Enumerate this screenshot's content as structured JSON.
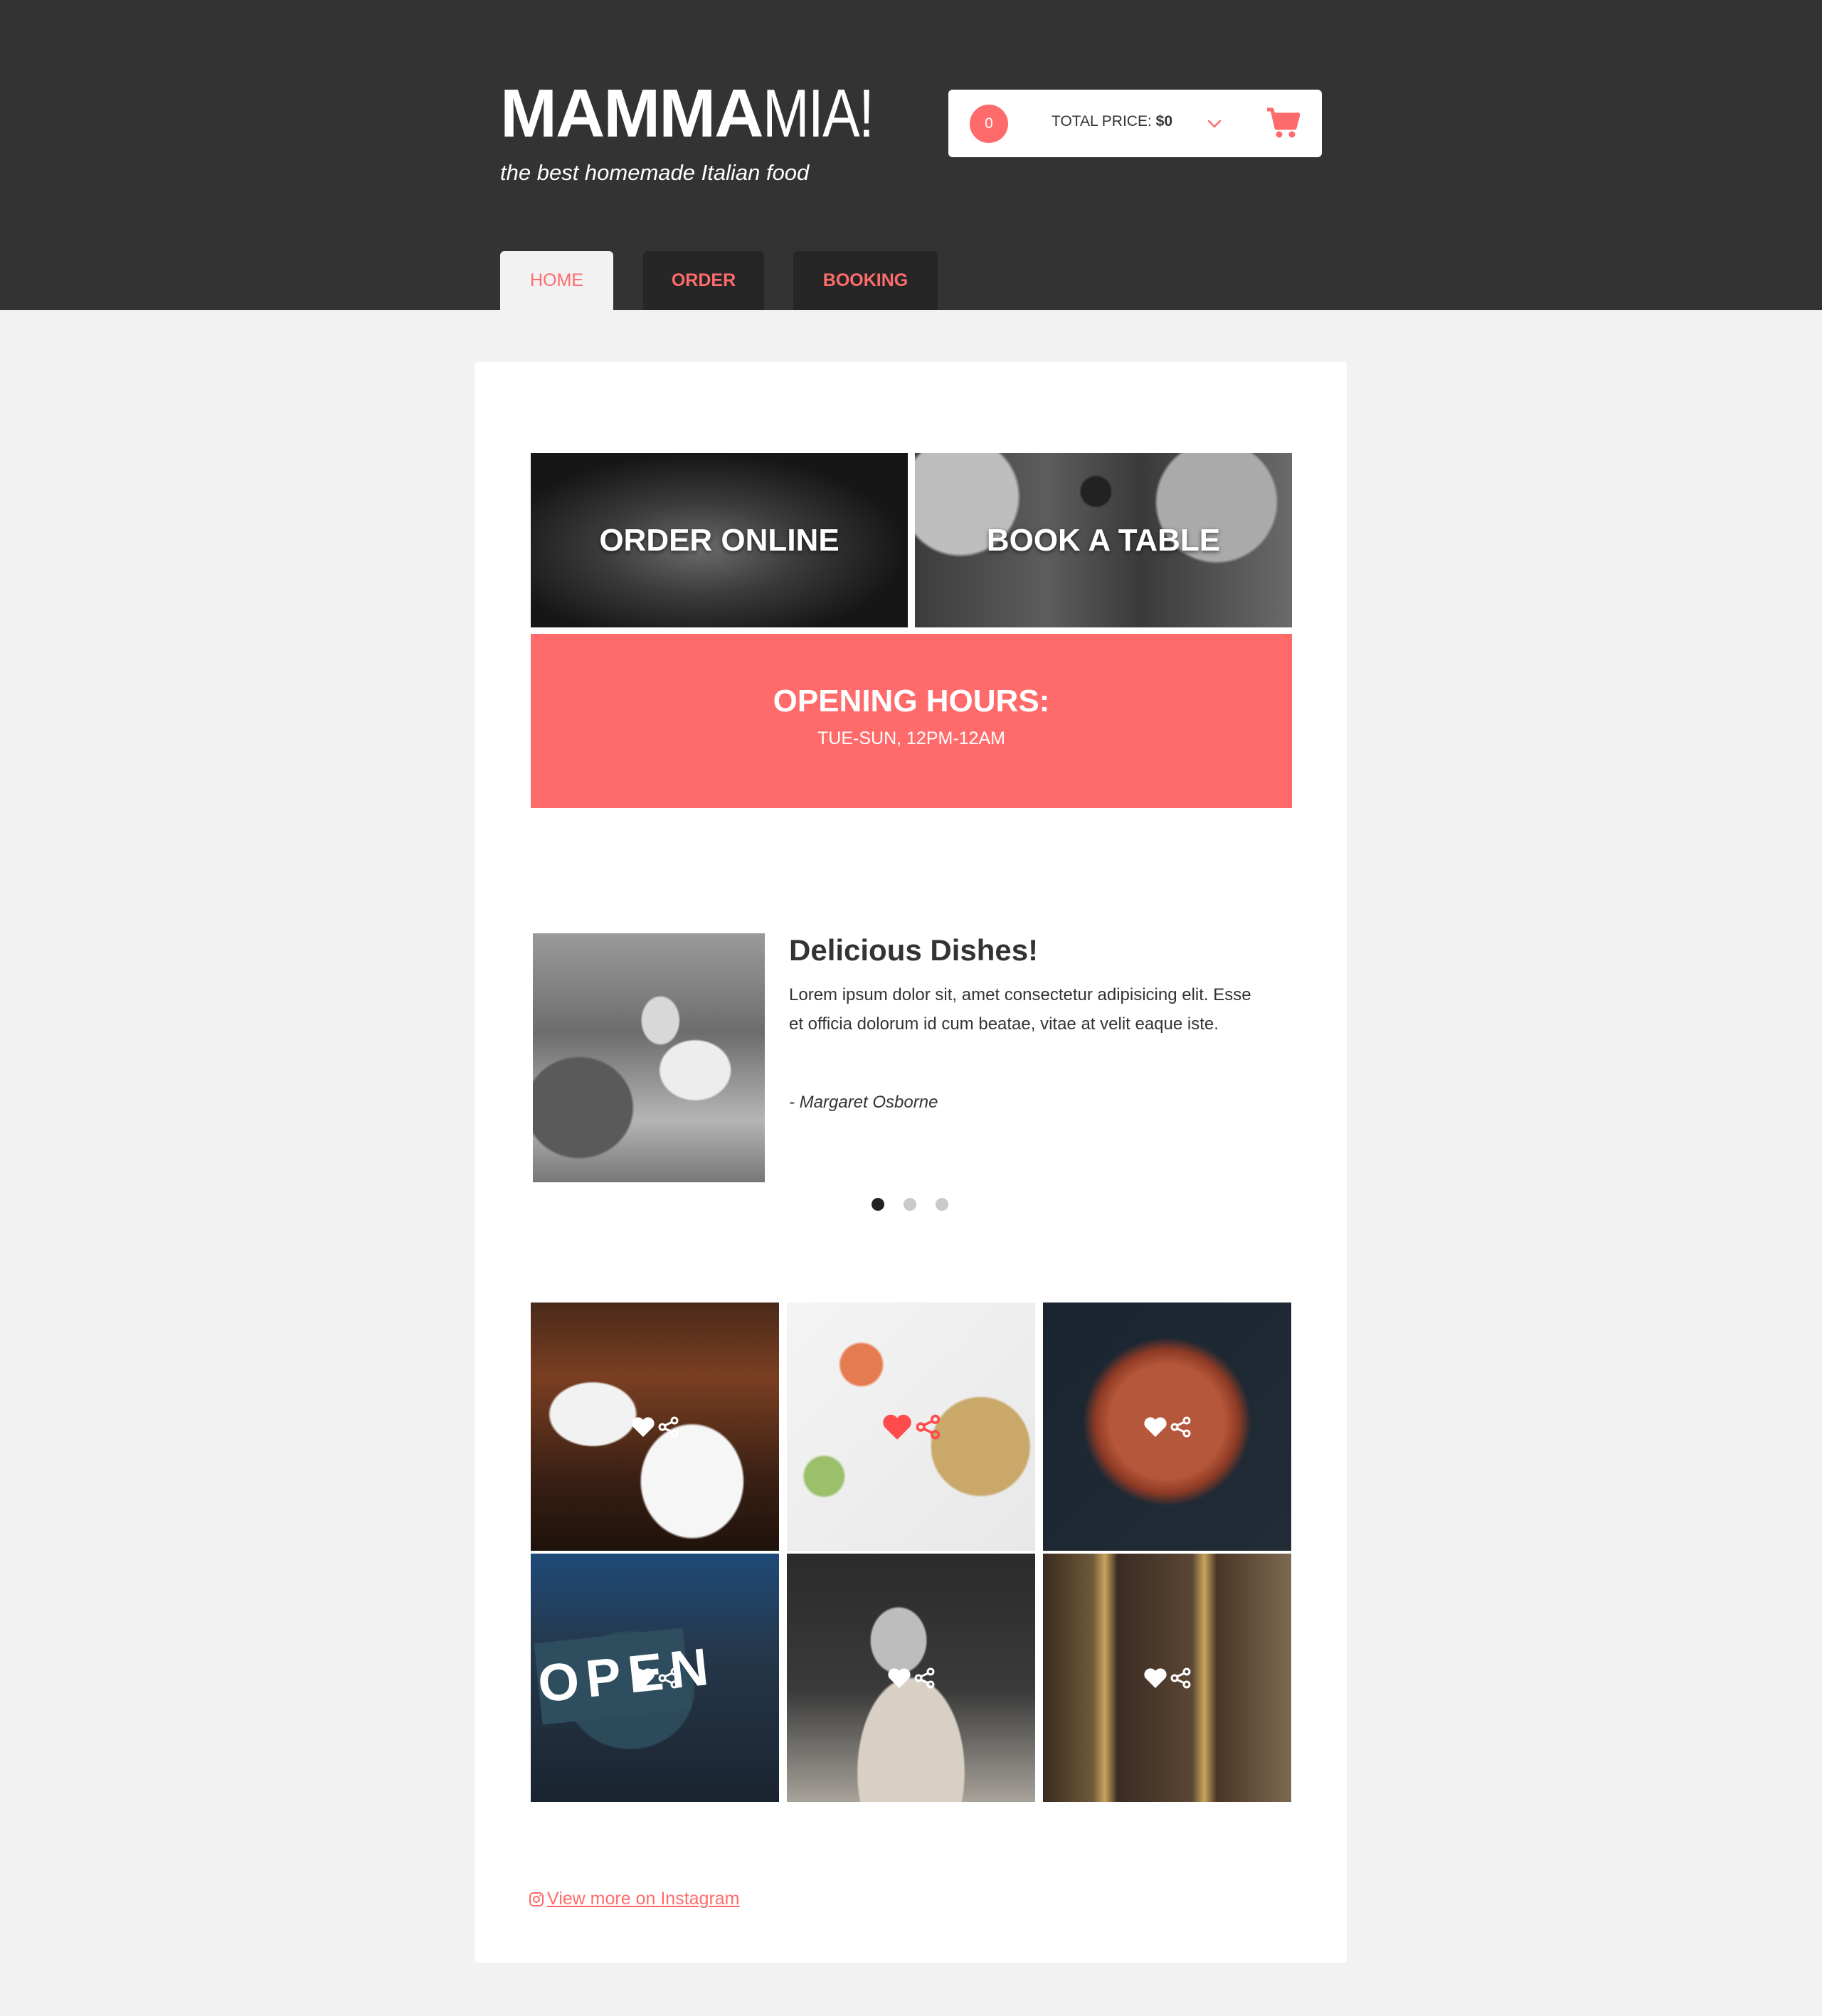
{
  "brand": {
    "logo_bold": "MAMMA",
    "logo_light": "MIA!",
    "tagline": "the best homemade Italian food"
  },
  "cart": {
    "count": "0",
    "total_label": "TOTAL PRICE:",
    "total_value": "$0",
    "icon": "shopping-cart-icon",
    "toggle_icon": "chevron-down-icon"
  },
  "nav": {
    "tabs": [
      {
        "label": "HOME",
        "active": true
      },
      {
        "label": "ORDER",
        "active": false
      },
      {
        "label": "BOOKING",
        "active": false
      }
    ]
  },
  "promos": {
    "order_online": "ORDER ONLINE",
    "book_table": "BOOK A TABLE"
  },
  "hours": {
    "title": "OPENING HOURS:",
    "time": "TUE-SUN, 12PM-12AM"
  },
  "review": {
    "title": "Delicious Dishes!",
    "text": "Lorem ipsum dolor sit, amet consectetur adipisicing elit. Esse et officia dolorum id cum beatae, vitae at velit eaque iste.",
    "author": "- Margaret Osborne",
    "slides": 3,
    "active_slide": 1
  },
  "gallery": {
    "items": [
      {
        "name": "restaurant-dishes",
        "liked": false
      },
      {
        "name": "healthy-bowl",
        "liked": true
      },
      {
        "name": "sliced-pizza",
        "liked": false
      },
      {
        "name": "open-sign",
        "liked": false,
        "sign_text": "OPEN"
      },
      {
        "name": "pizza-dough",
        "liked": false
      },
      {
        "name": "shop-door",
        "liked": false
      }
    ]
  },
  "instagram": {
    "link": "View more on Instagram",
    "icon": "instagram-icon"
  },
  "colors": {
    "accent": "#ff6b6b",
    "header_bg": "#333333",
    "tab_bg": "#262626",
    "page_bg": "#f2f2f2"
  }
}
